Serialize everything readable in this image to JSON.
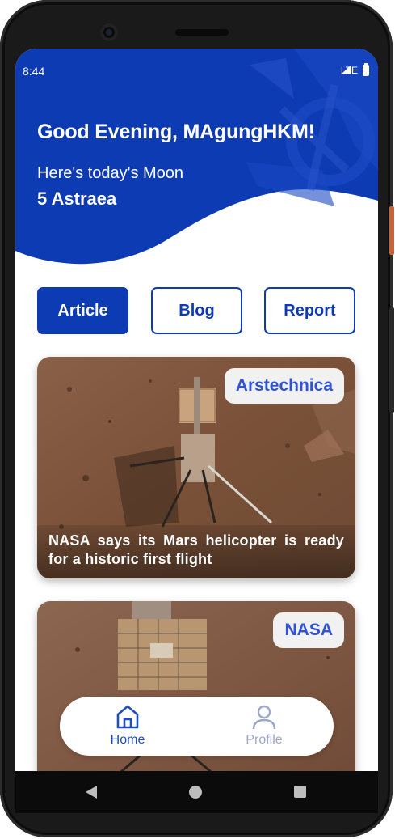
{
  "status_bar": {
    "time": "8:44",
    "network": "LTE"
  },
  "header": {
    "greeting": "Good Evening, MAgungHKM!",
    "moon_caption": "Here's today's Moon",
    "moon_name": "5 Astraea"
  },
  "tabs": [
    {
      "label": "Article",
      "active": true
    },
    {
      "label": "Blog",
      "active": false
    },
    {
      "label": "Report",
      "active": false
    }
  ],
  "articles": [
    {
      "source": "Arstechnica",
      "title": "NASA says its Mars helicopter is ready for a historic first flight"
    },
    {
      "source": "NASA",
      "title": ""
    }
  ],
  "bottom_nav": [
    {
      "label": "Home",
      "icon": "home-icon",
      "active": true
    },
    {
      "label": "Profile",
      "icon": "profile-icon",
      "active": false
    }
  ],
  "colors": {
    "brand_blue": "#0d3bb3",
    "accent_blue": "#2f52d6",
    "inactive_nav": "#9aa7c9"
  }
}
